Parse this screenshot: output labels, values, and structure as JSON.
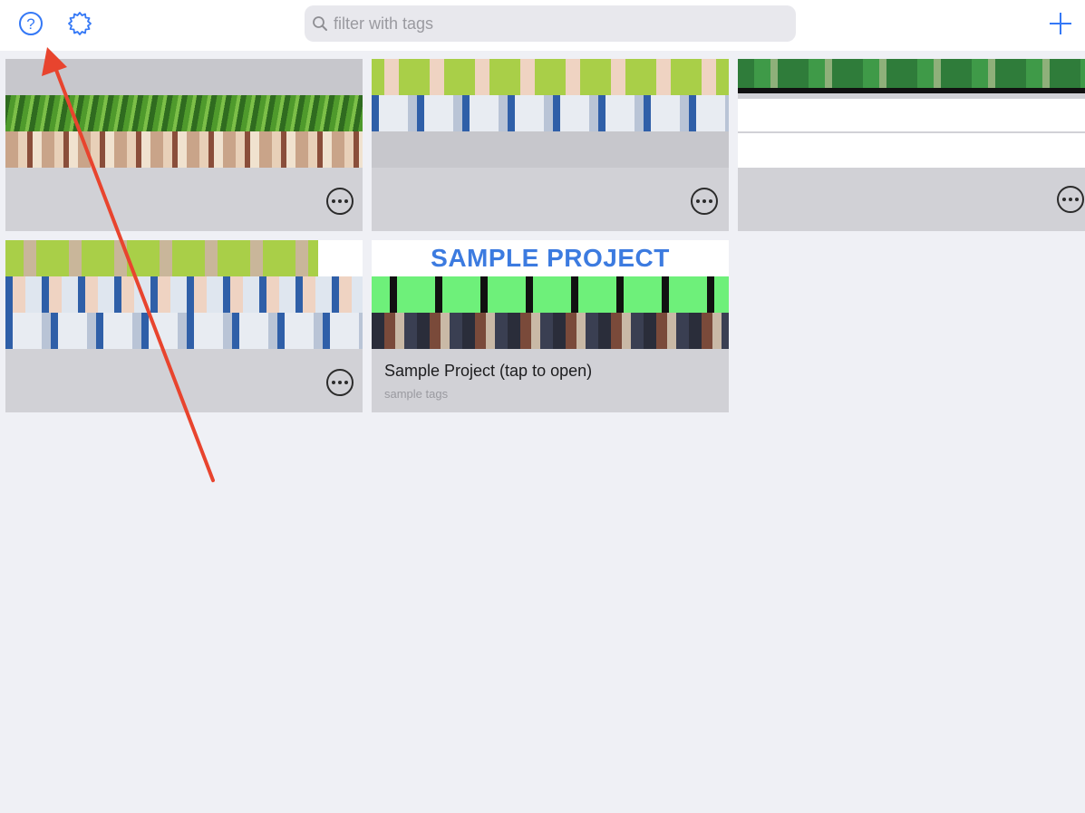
{
  "toolbar": {
    "help_icon": "question-circle-icon",
    "settings_icon": "gear-icon",
    "add_icon": "plus-icon",
    "accent_color": "#3478f6"
  },
  "search": {
    "placeholder": "filter with tags",
    "value": ""
  },
  "projects": [
    {
      "name": "",
      "tags": ""
    },
    {
      "name": "",
      "tags": ""
    },
    {
      "name": "",
      "tags": ""
    },
    {
      "name": "",
      "tags": ""
    },
    {
      "title_banner": "SAMPLE PROJECT",
      "name": "Sample Project (tap to open)",
      "tags": "sample tags"
    }
  ],
  "annotation": {
    "arrow_color": "#e8442e"
  }
}
